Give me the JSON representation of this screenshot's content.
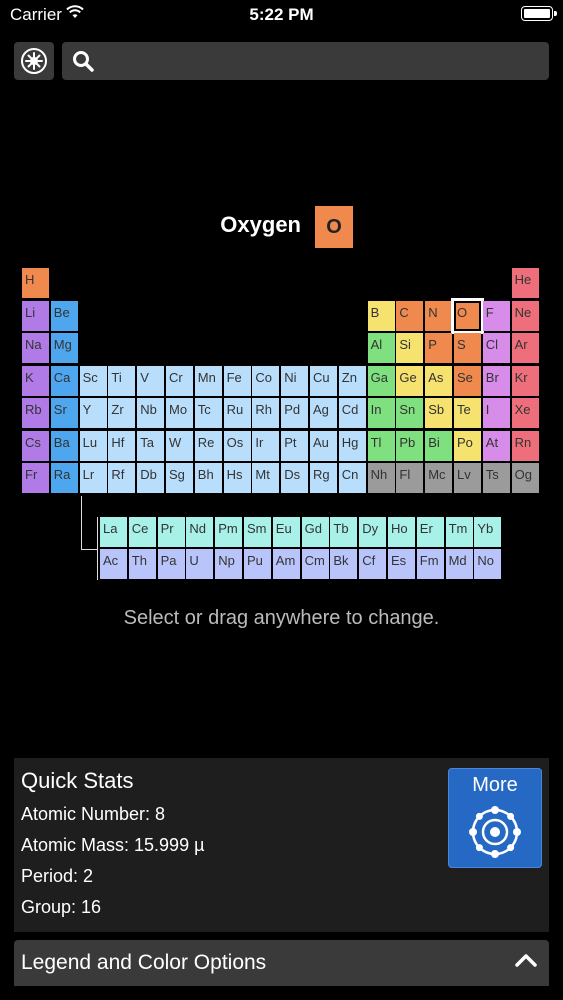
{
  "status_bar": {
    "carrier": "Carrier",
    "time": "5:22 PM"
  },
  "toolbar": {
    "search_placeholder": ""
  },
  "selected": {
    "name": "Oxygen",
    "symbol": "O",
    "color": "#f0894d"
  },
  "hint": "Select or drag anywhere to change.",
  "colors": {
    "alkali": "#b07be6",
    "alkaline": "#4ea6ee",
    "transition": "#b9defc",
    "lanthanide": "#a7f1e8",
    "actinide": "#b9c4fb",
    "poor_metal": "#7fe07f",
    "metalloid": "#f6e26e",
    "nonmetal": "#f0894d",
    "halogen": "#d68ce8",
    "noble_gas": "#ee6f7b",
    "unknown": "#9b9b9b"
  },
  "periodic_table": {
    "main_rows": [
      [
        "H",
        "",
        "",
        "",
        "",
        "",
        "",
        "",
        "",
        "",
        "",
        "",
        "",
        "",
        "",
        "",
        "",
        "He"
      ],
      [
        "Li",
        "Be",
        "",
        "",
        "",
        "",
        "",
        "",
        "",
        "",
        "",
        "",
        "B",
        "C",
        "N",
        "O",
        "F",
        "Ne"
      ],
      [
        "Na",
        "Mg",
        "",
        "",
        "",
        "",
        "",
        "",
        "",
        "",
        "",
        "",
        "Al",
        "Si",
        "P",
        "S",
        "Cl",
        "Ar"
      ],
      [
        "K",
        "Ca",
        "Sc",
        "Ti",
        "V",
        "Cr",
        "Mn",
        "Fe",
        "Co",
        "Ni",
        "Cu",
        "Zn",
        "Ga",
        "Ge",
        "As",
        "Se",
        "Br",
        "Kr"
      ],
      [
        "Rb",
        "Sr",
        "Y",
        "Zr",
        "Nb",
        "Mo",
        "Tc",
        "Ru",
        "Rh",
        "Pd",
        "Ag",
        "Cd",
        "In",
        "Sn",
        "Sb",
        "Te",
        "I",
        "Xe"
      ],
      [
        "Cs",
        "Ba",
        "Lu",
        "Hf",
        "Ta",
        "W",
        "Re",
        "Os",
        "Ir",
        "Pt",
        "Au",
        "Hg",
        "Tl",
        "Pb",
        "Bi",
        "Po",
        "At",
        "Rn"
      ],
      [
        "Fr",
        "Ra",
        "Lr",
        "Rf",
        "Db",
        "Sg",
        "Bh",
        "Hs",
        "Mt",
        "Ds",
        "Rg",
        "Cn",
        "Nh",
        "Fl",
        "Mc",
        "Lv",
        "Ts",
        "Og"
      ]
    ],
    "lanthanides": [
      "La",
      "Ce",
      "Pr",
      "Nd",
      "Pm",
      "Sm",
      "Eu",
      "Gd",
      "Tb",
      "Dy",
      "Ho",
      "Er",
      "Tm",
      "Yb"
    ],
    "actinides": [
      "Ac",
      "Th",
      "Pa",
      "U",
      "Np",
      "Pu",
      "Am",
      "Cm",
      "Bk",
      "Cf",
      "Es",
      "Fm",
      "Md",
      "No"
    ]
  },
  "quick_stats": {
    "title": "Quick Stats",
    "atomic_number": "Atomic Number: 8",
    "atomic_mass": "Atomic Mass: 15.999 µ",
    "period": "Period: 2",
    "group": "Group: 16",
    "more_label": "More"
  },
  "legend": {
    "label": "Legend and Color Options"
  }
}
